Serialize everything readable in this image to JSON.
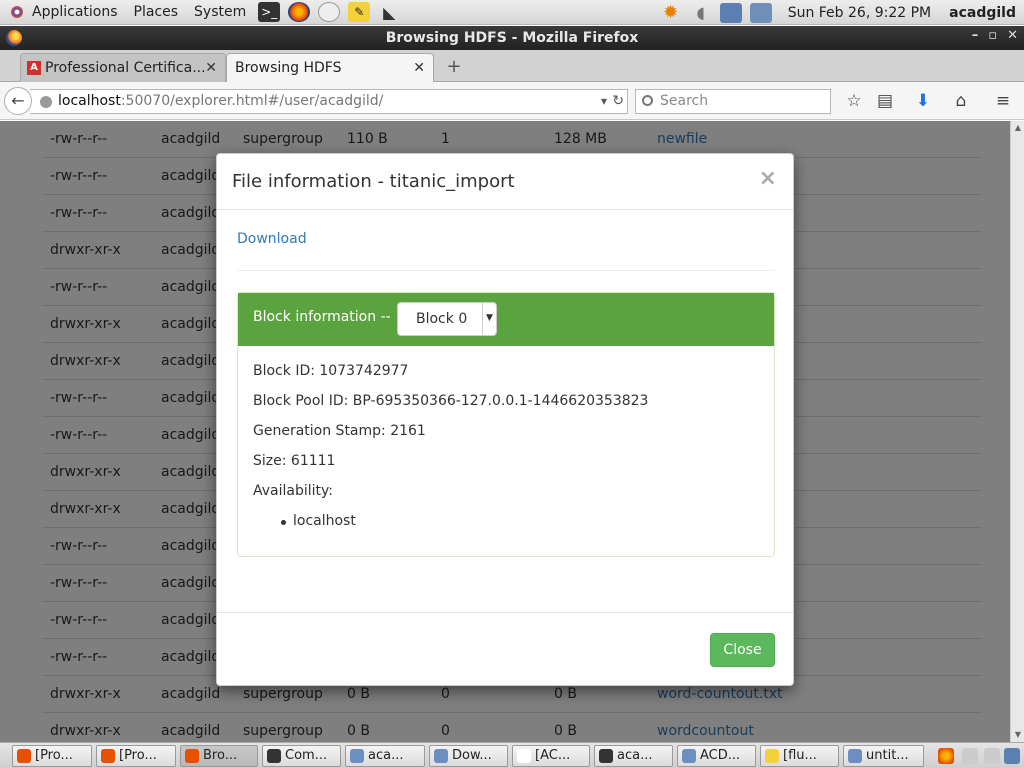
{
  "top_panel": {
    "menus": [
      "Applications",
      "Places",
      "System"
    ],
    "clock": "Sun Feb 26,  9:22 PM",
    "user": "acadgild"
  },
  "window": {
    "title": "Browsing HDFS - Mozilla Firefox"
  },
  "tabs": [
    {
      "label": "Professional Certifica..."
    },
    {
      "label": "Browsing HDFS"
    }
  ],
  "urlbar": {
    "host": "localhost",
    "path": ":50070/explorer.html#/user/acadgild/"
  },
  "search": {
    "placeholder": "Search"
  },
  "file_rows": [
    {
      "perm": "-rw-r--r--",
      "owner": "acadgild",
      "group": "supergroup",
      "size": "110 B",
      "repl": "1",
      "block": "128 MB",
      "name": "newfile"
    },
    {
      "perm": "-rw-r--r--",
      "owner": "acadgild"
    },
    {
      "perm": "-rw-r--r--",
      "owner": "acadgild"
    },
    {
      "perm": "drwxr-xr-x",
      "owner": "acadgild"
    },
    {
      "perm": "-rw-r--r--",
      "owner": "acadgild"
    },
    {
      "perm": "drwxr-xr-x",
      "owner": "acadgild"
    },
    {
      "perm": "drwxr-xr-x",
      "owner": "acadgild"
    },
    {
      "perm": "-rw-r--r--",
      "owner": "acadgild"
    },
    {
      "perm": "-rw-r--r--",
      "owner": "acadgild"
    },
    {
      "perm": "drwxr-xr-x",
      "owner": "acadgild"
    },
    {
      "perm": "drwxr-xr-x",
      "owner": "acadgild"
    },
    {
      "perm": "-rw-r--r--",
      "owner": "acadgild"
    },
    {
      "perm": "-rw-r--r--",
      "owner": "acadgild"
    },
    {
      "perm": "-rw-r--r--",
      "owner": "acadgild"
    },
    {
      "perm": "-rw-r--r--",
      "owner": "acadgild"
    },
    {
      "perm": "drwxr-xr-x",
      "owner": "acadgild",
      "group": "supergroup",
      "size": "0 B",
      "repl": "0",
      "block": "0 B",
      "name": "word-countout.txt"
    },
    {
      "perm": "drwxr-xr-x",
      "owner": "acadgild",
      "group": "supergroup",
      "size": "0 B",
      "repl": "0",
      "block": "0 B",
      "name": "wordcountout"
    }
  ],
  "modal": {
    "title": "File information - titanic_import",
    "close_x": "×",
    "download": "Download",
    "block_heading": "Block information --",
    "block_select": "Block 0",
    "block_id": "Block ID: 1073742977",
    "pool_id": "Block Pool ID: BP-695350366-127.0.0.1-1446620353823",
    "gen_stamp": "Generation Stamp: 2161",
    "size": "Size: 61111",
    "availability": "Availability:",
    "locations": [
      "localhost"
    ],
    "close_button": "Close"
  },
  "taskbar": [
    "[Pro...",
    "[Pro...",
    "Bro...",
    "Com...",
    "aca...",
    "Dow...",
    "[AC...",
    "aca...",
    "ACD...",
    "[flu...",
    "untit..."
  ],
  "colors": {
    "panel_green": "#5ba33f",
    "button_green": "#5cb85c",
    "link_blue": "#337ab7"
  }
}
